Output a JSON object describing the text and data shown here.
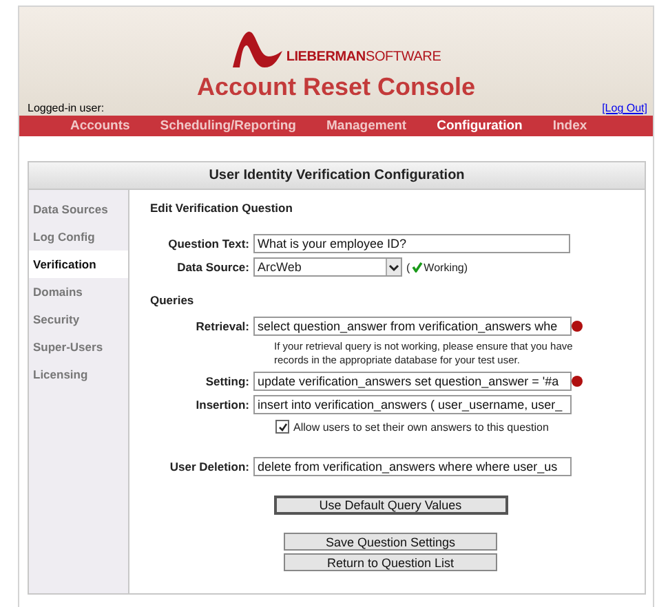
{
  "header": {
    "logo_text": "**LIEBERMAN**SOFTWARE",
    "title": "Account Reset Console",
    "logged_in_label": "Logged-in user:",
    "logout_link": "[Log Out]"
  },
  "nav": [
    {
      "label": "Accounts",
      "selected": false
    },
    {
      "label": "Scheduling/Reporting",
      "selected": false
    },
    {
      "label": "Management",
      "selected": false
    },
    {
      "label": "Configuration",
      "selected": true
    },
    {
      "label": "Index",
      "selected": false
    }
  ],
  "panel": {
    "title": "User Identity Verification Configuration"
  },
  "sidebar": {
    "items": [
      {
        "label": "Data Sources",
        "selected": false
      },
      {
        "label": "Log Config",
        "selected": false
      },
      {
        "label": "Verification",
        "selected": true
      },
      {
        "label": "Domains",
        "selected": false
      },
      {
        "label": "Security",
        "selected": false
      },
      {
        "label": "Super-Users",
        "selected": false
      },
      {
        "label": "Licensing",
        "selected": false
      }
    ]
  },
  "form": {
    "heading": "Edit Verification Question",
    "question_text": {
      "label": "Question Text:",
      "value": "What is your employee ID?"
    },
    "data_source": {
      "label": "Data Source:",
      "value": "ArcWeb",
      "status_open": "(",
      "status": "Working)",
      "working": true
    },
    "queries_heading": "Queries",
    "retrieval": {
      "label": "Retrieval:",
      "value": "select question_answer from verification_answers whe",
      "error": true
    },
    "retrieval_hint": "If your retrieval query is not working, please ensure that you have records in the appropriate database for your test user.",
    "setting": {
      "label": "Setting:",
      "value": "update verification_answers set question_answer = '#a",
      "error": true
    },
    "insertion": {
      "label": "Insertion:",
      "value": "insert into verification_answers ( user_username, user_",
      "error": false
    },
    "allow_users": {
      "label": "Allow users to set their own answers to this question",
      "checked": true
    },
    "user_deletion": {
      "label": "User Deletion:",
      "value": "delete from verification_answers where where user_us",
      "error": false
    }
  },
  "buttons": [
    "Use Default Query Values",
    "Save Question Settings",
    "Return to Question List"
  ]
}
